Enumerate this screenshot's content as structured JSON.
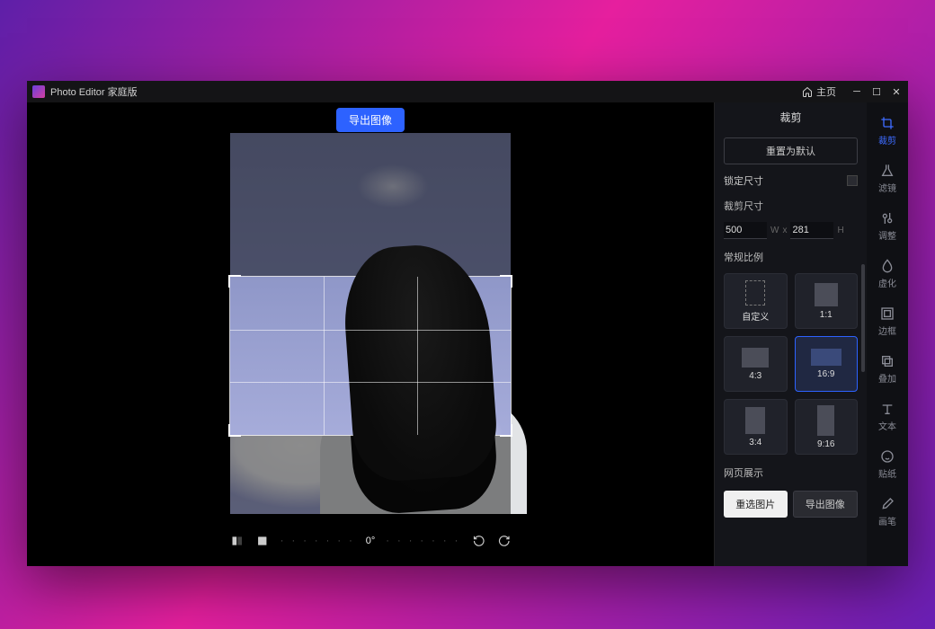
{
  "titlebar": {
    "app_name": "Photo Editor 家庭版",
    "home_label": "主页"
  },
  "toolbar": {
    "export_image": "导出图像"
  },
  "rotate": {
    "angle": "0°"
  },
  "panel": {
    "title": "裁剪",
    "reset_default": "重置为默认",
    "lock_size": "锁定尺寸",
    "crop_size": "裁剪尺寸",
    "width_value": "500",
    "width_label": "W",
    "x": "x",
    "height_value": "281",
    "height_label": "H",
    "common_ratio": "常规比例",
    "ratios": [
      "自定义",
      "1:1",
      "4:3",
      "16:9",
      "3:4",
      "9:16"
    ],
    "selected_ratio_index": 3,
    "web_display": "网页展示",
    "reselect_image": "重选图片",
    "export_image": "导出图像"
  },
  "tools": [
    {
      "id": "crop",
      "label": "裁剪",
      "active": true
    },
    {
      "id": "filter",
      "label": "滤镜",
      "active": false
    },
    {
      "id": "adjust",
      "label": "调整",
      "active": false
    },
    {
      "id": "blur",
      "label": "虚化",
      "active": false
    },
    {
      "id": "frame",
      "label": "边框",
      "active": false
    },
    {
      "id": "overlay",
      "label": "叠加",
      "active": false
    },
    {
      "id": "text",
      "label": "文本",
      "active": false
    },
    {
      "id": "sticker",
      "label": "贴纸",
      "active": false
    },
    {
      "id": "brush",
      "label": "画笔",
      "active": false
    }
  ]
}
